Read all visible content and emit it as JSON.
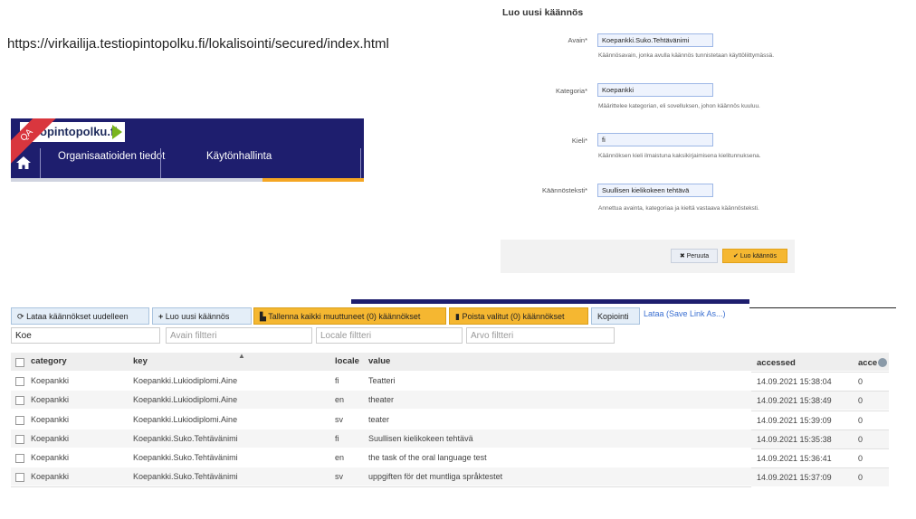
{
  "url_text": "https://virkailija.testiopintopolku.fi/lokalisointi/secured/index.html",
  "banner": {
    "logo": "opintopolku.fi",
    "qa_badge": "QA",
    "nav": [
      "Organisaatioiden tiedot",
      "Käytönhallinta"
    ]
  },
  "dialog": {
    "title": "Luo uusi käännös",
    "fields": [
      {
        "label": "Avain*",
        "value": "Koepankki.Suko.Tehtävänimi",
        "help": "Käännösavain, jonka avulla käännös tunnistetaan käyttöliittymässä."
      },
      {
        "label": "Kategoria*",
        "value": "Koepankki",
        "help": "Määrittelee kategorian, eli sovelluksen, johon käännös kuuluu."
      },
      {
        "label": "Kieli*",
        "value": "fi",
        "help": "Käännöksen kieli ilmaistuna kaksikirjaimisena kielitunnuksena."
      },
      {
        "label": "Käännösteksti*",
        "value": "Suullisen kielikokeen tehtävä",
        "help": "Annettua avainta, kategoriaa ja kieltä vastaava käännösteksti."
      }
    ],
    "cancel_label": "✖ Peruuta",
    "create_label": "✔ Luo käännös"
  },
  "toolbar": {
    "reload": "Lataa käännökset uudelleen",
    "create": "Luo uusi käännös",
    "save_all": "Tallenna kaikki muuttuneet (0) käännökset",
    "delete_selected": "Poista valitut (0) käännökset",
    "copy": "Kopiointi",
    "download_link": "Lataa (Save Link As...)"
  },
  "filters": {
    "category_value": "Koe",
    "key_placeholder": "Avain filtteri",
    "locale_placeholder": "Locale filtteri",
    "value_placeholder": "Arvo filtteri"
  },
  "table": {
    "headers": {
      "category": "category",
      "key": "key",
      "locale": "locale",
      "value": "value",
      "accessed": "accessed",
      "acce": "acce"
    },
    "rows": [
      {
        "category": "Koepankki",
        "key": "Koepankki.Lukiodiplomi.Aine",
        "locale": "fi",
        "value": "Teatteri",
        "accessed": "14.09.2021 15:38:04",
        "acce": "0"
      },
      {
        "category": "Koepankki",
        "key": "Koepankki.Lukiodiplomi.Aine",
        "locale": "en",
        "value": "theater",
        "accessed": "14.09.2021 15:38:49",
        "acce": "0"
      },
      {
        "category": "Koepankki",
        "key": "Koepankki.Lukiodiplomi.Aine",
        "locale": "sv",
        "value": "teater",
        "accessed": "14.09.2021 15:39:09",
        "acce": "0"
      },
      {
        "category": "Koepankki",
        "key": "Koepankki.Suko.Tehtävänimi",
        "locale": "fi",
        "value": "Suullisen kielikokeen tehtävä",
        "accessed": "14.09.2021 15:35:38",
        "acce": "0"
      },
      {
        "category": "Koepankki",
        "key": "Koepankki.Suko.Tehtävänimi",
        "locale": "en",
        "value": "the task of the oral language test",
        "accessed": "14.09.2021 15:36:41",
        "acce": "0"
      },
      {
        "category": "Koepankki",
        "key": "Koepankki.Suko.Tehtävänimi",
        "locale": "sv",
        "value": "uppgiften för det muntliga språktestet",
        "accessed": "14.09.2021 15:37:09",
        "acce": "0"
      }
    ]
  },
  "colors": {
    "navy": "#1e1e6e",
    "accent": "#f5b731",
    "link": "#3a6fd1"
  }
}
